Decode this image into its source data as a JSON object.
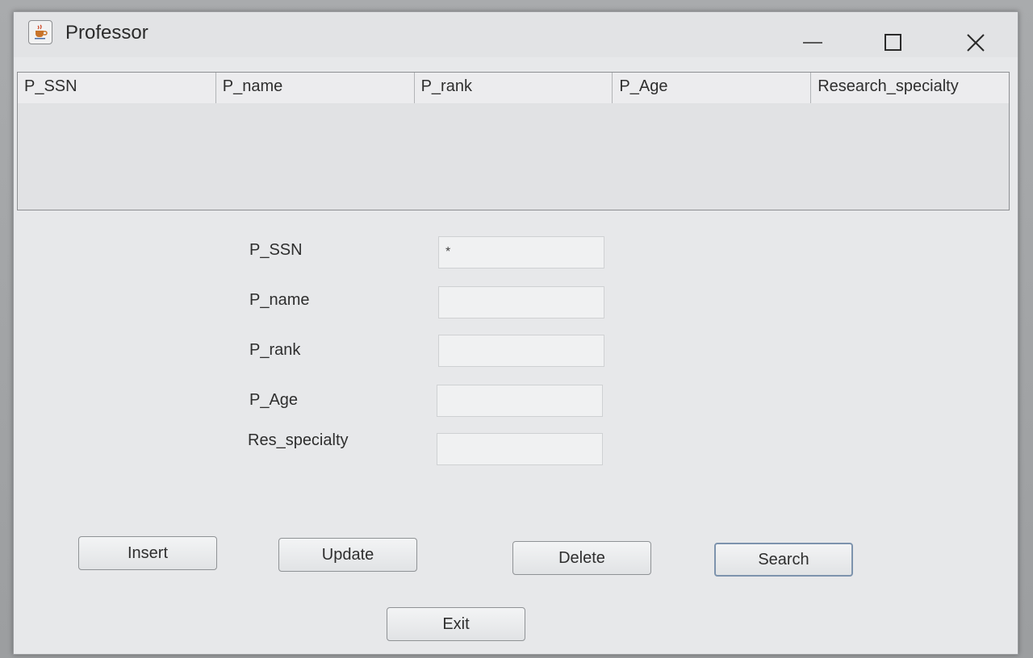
{
  "window": {
    "title": "Professor",
    "icons": [
      "java-cup-icon",
      "minimize-icon",
      "maximize-icon",
      "close-icon"
    ]
  },
  "table": {
    "columns": [
      "P_SSN",
      "P_name",
      "P_rank",
      "P_Age",
      "Research_specialty"
    ],
    "rows": []
  },
  "form": {
    "fields": [
      {
        "label": "P_SSN",
        "value": "*"
      },
      {
        "label": "P_name",
        "value": ""
      },
      {
        "label": "P_rank",
        "value": ""
      },
      {
        "label": "P_Age",
        "value": ""
      },
      {
        "label": "Res_specialty",
        "value": ""
      }
    ]
  },
  "buttons": {
    "insert": "Insert",
    "update": "Update",
    "delete": "Delete",
    "search": "Search",
    "exit": "Exit"
  }
}
